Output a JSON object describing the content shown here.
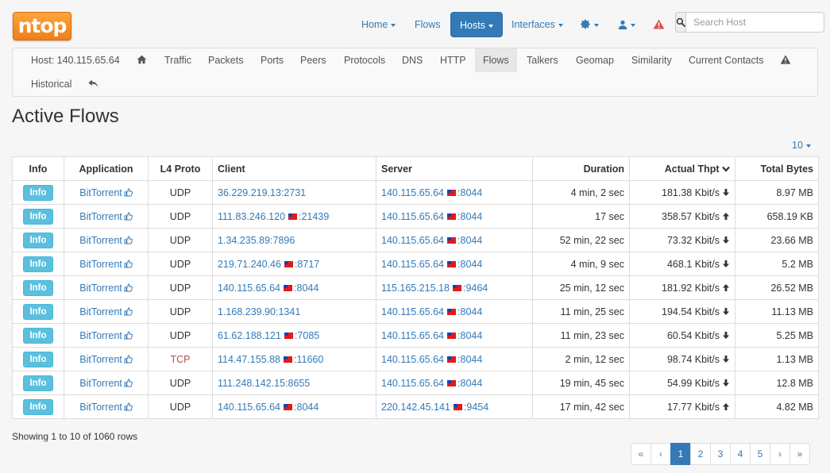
{
  "app": {
    "logo_text": "ntop"
  },
  "nav": {
    "home": "Home",
    "flows": "Flows",
    "hosts": "Hosts",
    "interfaces": "Interfaces"
  },
  "search": {
    "placeholder": "Search Host"
  },
  "subnav": {
    "host_label": "Host: 140.115.65.64",
    "items": [
      "Traffic",
      "Packets",
      "Ports",
      "Peers",
      "Protocols",
      "DNS",
      "HTTP",
      "Flows",
      "Talkers",
      "Geomap",
      "Similarity",
      "Current Contacts"
    ],
    "active": "Flows",
    "historical": "Historical"
  },
  "page": {
    "title": "Active Flows",
    "page_size": "10"
  },
  "table": {
    "headers": [
      "Info",
      "Application",
      "L4 Proto",
      "Client",
      "Server",
      "Duration",
      "Actual Thpt",
      "Total Bytes"
    ],
    "info_label": "Info",
    "rows": [
      {
        "app": "BitTorrent",
        "proto": "UDP",
        "client": "36.229.219.13:2731",
        "client_flag": false,
        "server": "140.115.65.64",
        "server_port": ":8044",
        "server_flag": true,
        "duration": "4 min, 2 sec",
        "thpt": "181.38 Kbit/s",
        "trend": "down",
        "bytes": "8.97 MB"
      },
      {
        "app": "BitTorrent",
        "proto": "UDP",
        "client": "111.83.246.120",
        "client_port": ":21439",
        "client_flag": true,
        "server": "140.115.65.64",
        "server_port": ":8044",
        "server_flag": true,
        "duration": "17 sec",
        "thpt": "358.57 Kbit/s",
        "trend": "up",
        "bytes": "658.19 KB"
      },
      {
        "app": "BitTorrent",
        "proto": "UDP",
        "client": "1.34.235.89:7896",
        "client_flag": false,
        "server": "140.115.65.64",
        "server_port": ":8044",
        "server_flag": true,
        "duration": "52 min, 22 sec",
        "thpt": "73.32 Kbit/s",
        "trend": "down",
        "bytes": "23.66 MB"
      },
      {
        "app": "BitTorrent",
        "proto": "UDP",
        "client": "219.71.240.46",
        "client_port": ":8717",
        "client_flag": true,
        "server": "140.115.65.64",
        "server_port": ":8044",
        "server_flag": true,
        "duration": "4 min, 9 sec",
        "thpt": "468.1 Kbit/s",
        "trend": "down",
        "bytes": "5.2 MB"
      },
      {
        "app": "BitTorrent",
        "proto": "UDP",
        "client": "140.115.65.64",
        "client_port": ":8044",
        "client_flag": true,
        "server": "115.165.215.18",
        "server_port": ":9464",
        "server_flag": true,
        "duration": "25 min, 12 sec",
        "thpt": "181.92 Kbit/s",
        "trend": "up",
        "bytes": "26.52 MB"
      },
      {
        "app": "BitTorrent",
        "proto": "UDP",
        "client": "1.168.239.90:1341",
        "client_flag": false,
        "server": "140.115.65.64",
        "server_port": ":8044",
        "server_flag": true,
        "duration": "11 min, 25 sec",
        "thpt": "194.54 Kbit/s",
        "trend": "down",
        "bytes": "11.13 MB"
      },
      {
        "app": "BitTorrent",
        "proto": "UDP",
        "client": "61.62.188.121",
        "client_port": ":7085",
        "client_flag": true,
        "server": "140.115.65.64",
        "server_port": ":8044",
        "server_flag": true,
        "duration": "11 min, 23 sec",
        "thpt": "60.54 Kbit/s",
        "trend": "down",
        "bytes": "5.25 MB"
      },
      {
        "app": "BitTorrent",
        "proto": "TCP",
        "client": "114.47.155.88",
        "client_port": ":11660",
        "client_flag": true,
        "server": "140.115.65.64",
        "server_port": ":8044",
        "server_flag": true,
        "duration": "2 min, 12 sec",
        "thpt": "98.74 Kbit/s",
        "trend": "down",
        "bytes": "1.13 MB"
      },
      {
        "app": "BitTorrent",
        "proto": "UDP",
        "client": "111.248.142.15:8655",
        "client_flag": false,
        "server": "140.115.65.64",
        "server_port": ":8044",
        "server_flag": true,
        "duration": "19 min, 45 sec",
        "thpt": "54.99 Kbit/s",
        "trend": "down",
        "bytes": "12.8 MB"
      },
      {
        "app": "BitTorrent",
        "proto": "UDP",
        "client": "140.115.65.64",
        "client_port": ":8044",
        "client_flag": true,
        "server": "220.142.45.141",
        "server_port": ":9454",
        "server_flag": true,
        "duration": "17 min, 42 sec",
        "thpt": "17.77 Kbit/s",
        "trend": "up",
        "bytes": "4.82 MB"
      }
    ]
  },
  "footer": {
    "showing": "Showing 1 to 10 of 1060 rows",
    "pages": [
      "«",
      "‹",
      "1",
      "2",
      "3",
      "4",
      "5",
      "›",
      "»"
    ],
    "active_page": "1"
  },
  "colors": {
    "primary": "#337ab7",
    "info": "#5bc0de",
    "logo": "#f5901f",
    "alert": "#d9534f",
    "tcp": "#b94a48"
  }
}
